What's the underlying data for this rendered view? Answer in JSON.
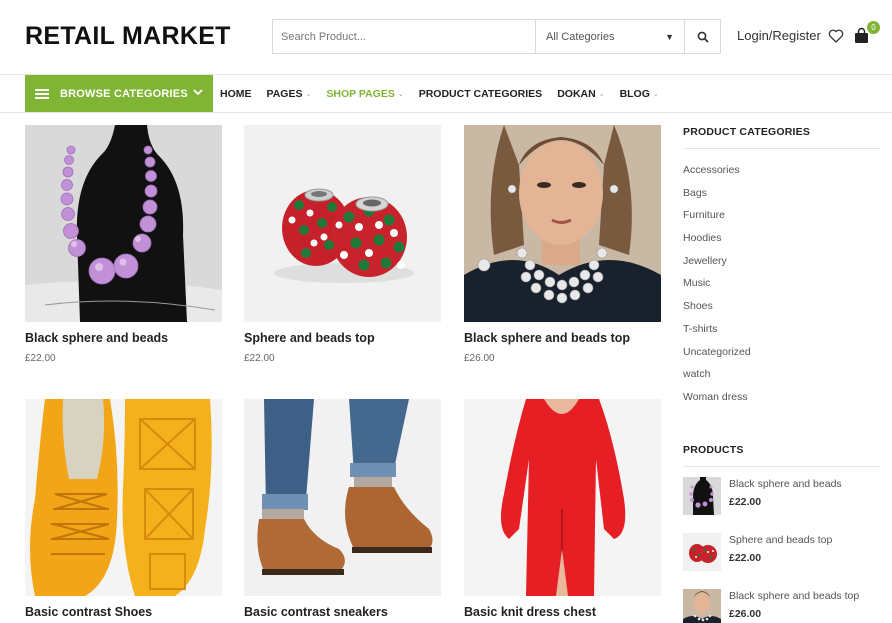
{
  "header": {
    "logo": "RETAIL MARKET",
    "search_placeholder": "Search Product...",
    "category_select": "All Categories",
    "login": "Login/Register",
    "cart_count": "0"
  },
  "nav": {
    "browse": "BROWSE CATEGORIES",
    "items": [
      {
        "label": "HOME",
        "dropdown": false,
        "active": false
      },
      {
        "label": "PAGES",
        "dropdown": true,
        "active": false
      },
      {
        "label": "SHOP PAGES",
        "dropdown": true,
        "active": true
      },
      {
        "label": "PRODUCT CATEGORIES",
        "dropdown": false,
        "active": false
      },
      {
        "label": "DOKAN",
        "dropdown": true,
        "active": false
      },
      {
        "label": "BLOG",
        "dropdown": true,
        "active": false
      }
    ]
  },
  "products": [
    {
      "title": "Black sphere and beads",
      "price": "£22.00"
    },
    {
      "title": "Sphere and beads top",
      "price": "£22.00"
    },
    {
      "title": "Black sphere and beads top",
      "price": "£26.00"
    },
    {
      "title": "Basic contrast Shoes",
      "price": ""
    },
    {
      "title": "Basic contrast sneakers",
      "price": ""
    },
    {
      "title": "Basic knit dress chest",
      "price": ""
    }
  ],
  "sidebar": {
    "categories_title": "PRODUCT CATEGORIES",
    "categories": [
      "Accessories",
      "Bags",
      "Furniture",
      "Hoodies",
      "Jewellery",
      "Music",
      "Shoes",
      "T-shirts",
      "Uncategorized",
      "watch",
      "Woman dress"
    ],
    "products_title": "PRODUCTS",
    "products": [
      {
        "name": "Black sphere and beads",
        "price": "£22.00"
      },
      {
        "name": "Sphere and beads top",
        "price": "£22.00"
      },
      {
        "name": "Black sphere and beads top",
        "price": "£26.00"
      }
    ]
  },
  "colors": {
    "accent": "#80b435"
  }
}
